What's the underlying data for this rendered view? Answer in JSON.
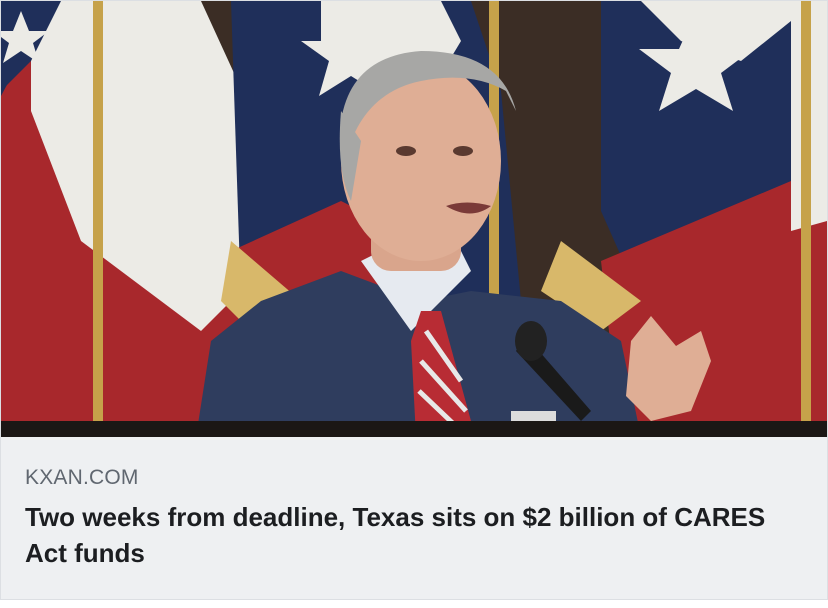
{
  "link_preview": {
    "image": {
      "description_icon": "photo-of-speaker-at-podium-with-texas-flags"
    },
    "source_domain": "KXAN.COM",
    "headline": "Two weeks from deadline, Texas sits on $2 billion of CARES Act funds"
  },
  "colors": {
    "meta_background": "#eef0f2",
    "domain_text": "#606770",
    "headline_text": "#1c1e21",
    "flag_red": "#a8282c",
    "flag_blue": "#1f2f5a",
    "flag_white": "#ecebe6"
  }
}
